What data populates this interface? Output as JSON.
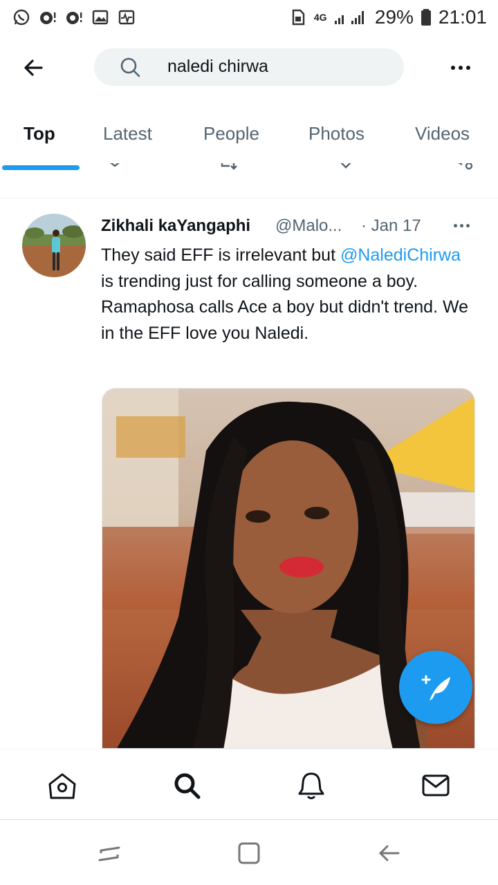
{
  "status_bar": {
    "network": "4G",
    "battery_percent": "29%",
    "time": "21:01",
    "icons": [
      "whatsapp-icon",
      "notification-icon",
      "notification-icon",
      "gallery-icon",
      "activity-icon"
    ]
  },
  "search": {
    "query": "naledi chirwa"
  },
  "tabs": [
    {
      "label": "Top",
      "active": true
    },
    {
      "label": "Latest",
      "active": false
    },
    {
      "label": "People",
      "active": false
    },
    {
      "label": "Photos",
      "active": false
    },
    {
      "label": "Videos",
      "active": false
    }
  ],
  "tweet": {
    "author": "Zikhali kaYangaphi",
    "handle": "@Malo...",
    "date": "· Jan 17",
    "text_before": "They said EFF is irrelevant but ",
    "mention": "@NalediChirwa",
    "text_after": " is trending just for calling someone a boy. Ramaphosa calls Ace a boy but didn't trend. We in the EFF love you Naledi."
  },
  "colors": {
    "accent": "#1d9bf0",
    "text_primary": "#0f1419",
    "text_secondary": "#536471",
    "search_bg": "#eff3f4"
  },
  "bottom_nav": [
    "home-icon",
    "search-icon",
    "notifications-icon",
    "messages-icon"
  ]
}
